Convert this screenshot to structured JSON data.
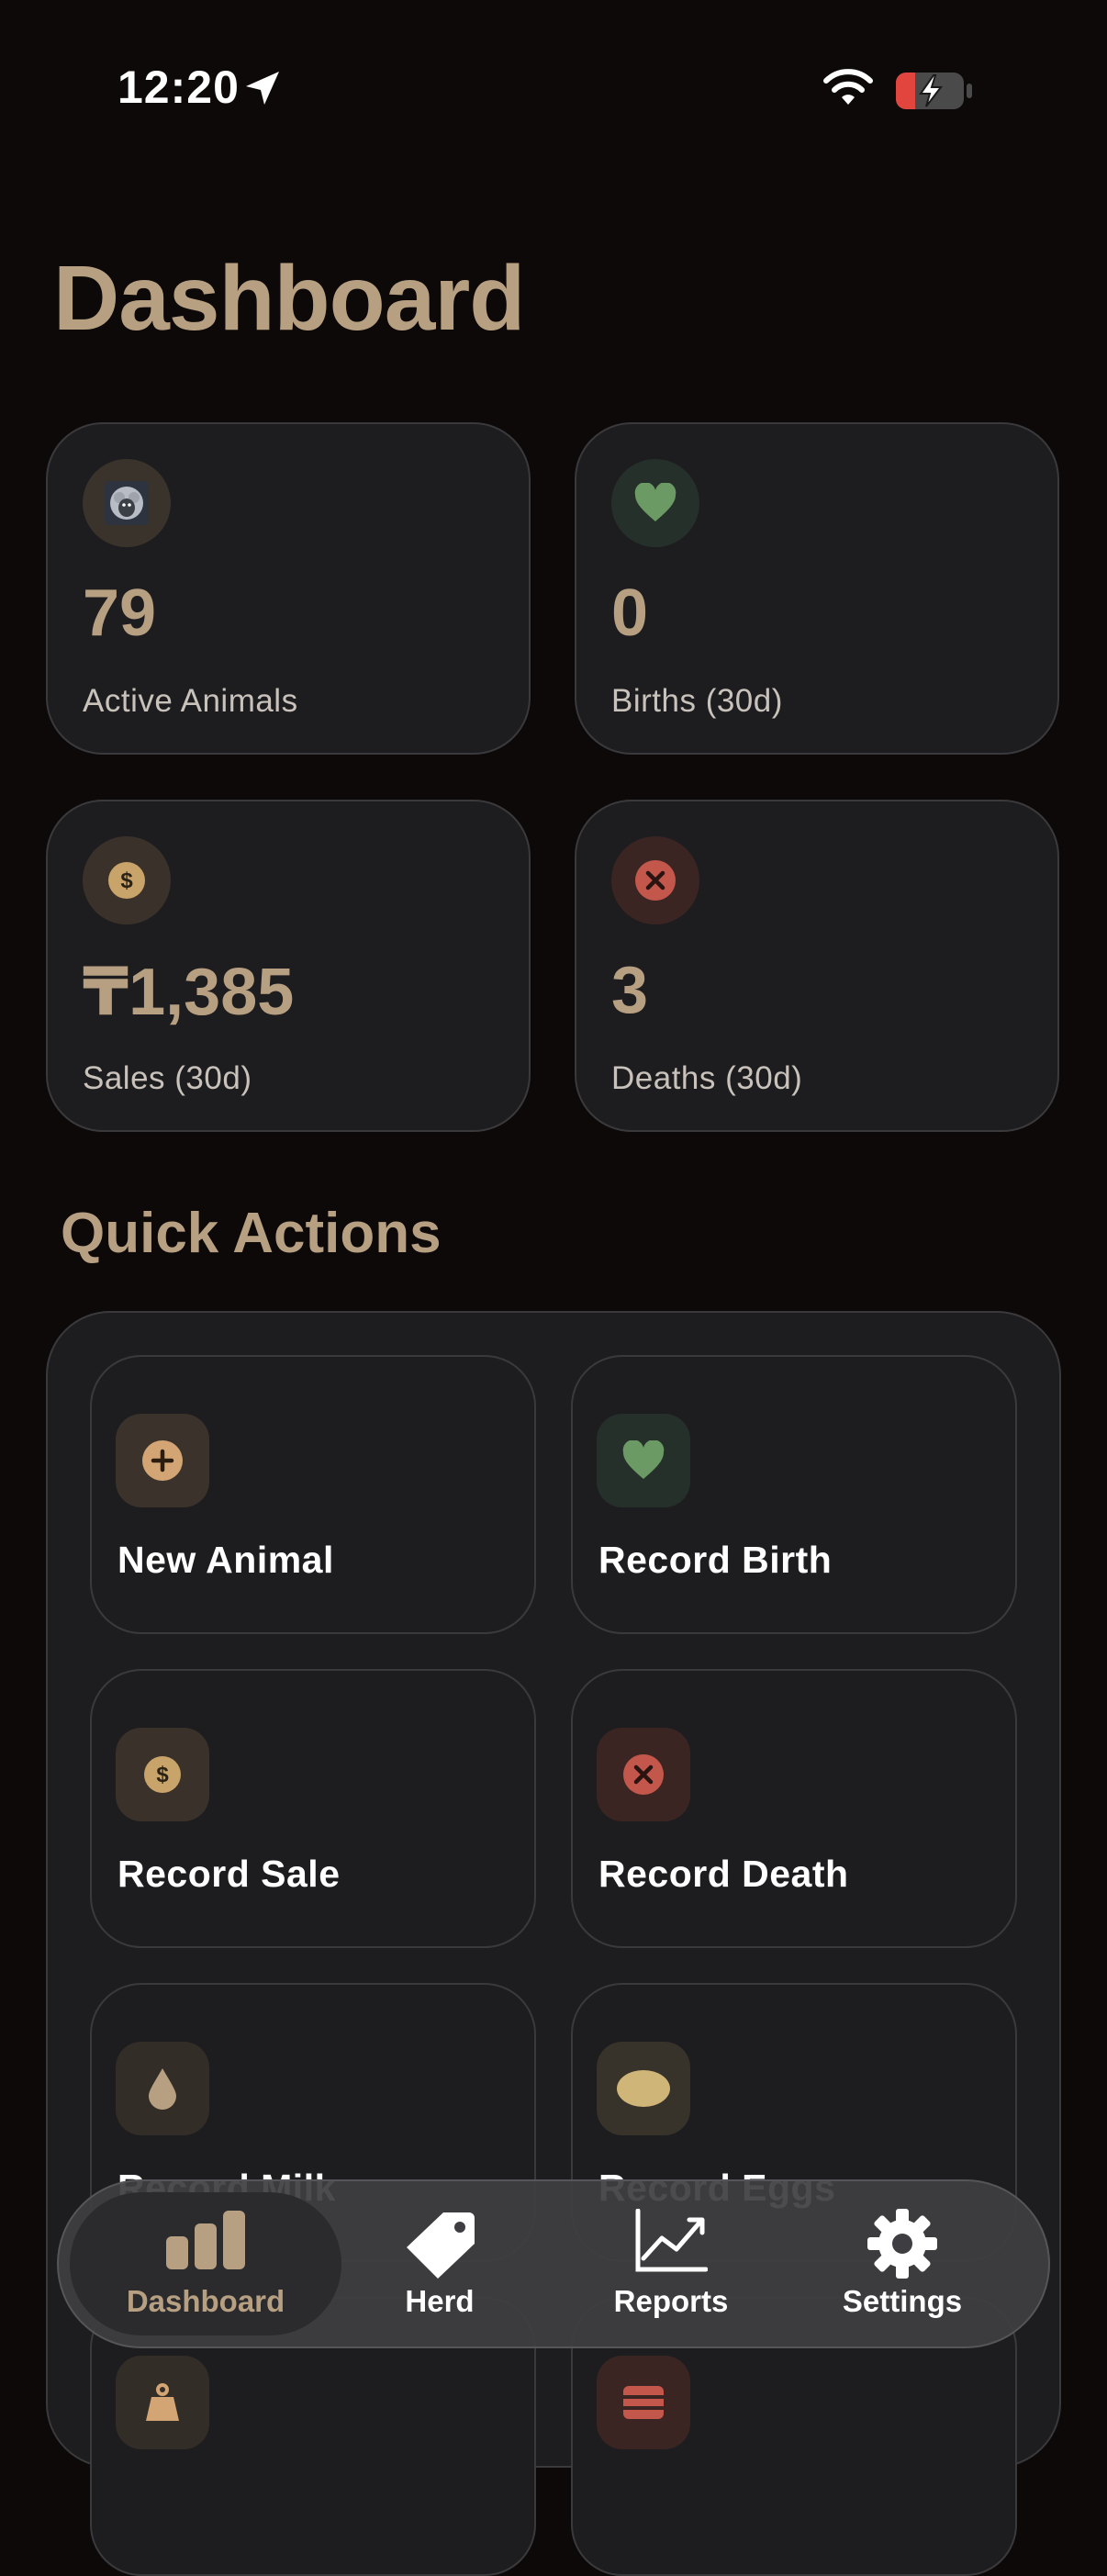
{
  "status_bar": {
    "time": "12:20"
  },
  "page": {
    "title": "Dashboard"
  },
  "stats": [
    {
      "value": "79",
      "label": "Active Animals",
      "icon": "sheep-icon"
    },
    {
      "value": "0",
      "label": "Births (30d)",
      "icon": "heart-icon"
    },
    {
      "value": "₸1,385",
      "label": "Sales (30d)",
      "icon": "dollar-icon"
    },
    {
      "value": "3",
      "label": "Deaths (30d)",
      "icon": "x-circle-icon"
    }
  ],
  "quick_actions": {
    "title": "Quick Actions",
    "items": [
      {
        "label": "New Animal",
        "icon": "plus-circle-icon"
      },
      {
        "label": "Record Birth",
        "icon": "heart-icon"
      },
      {
        "label": "Record Sale",
        "icon": "dollar-icon"
      },
      {
        "label": "Record Death",
        "icon": "x-circle-icon"
      },
      {
        "label": "Record Milk",
        "icon": "drop-icon"
      },
      {
        "label": "Record Eggs",
        "icon": "egg-icon"
      }
    ]
  },
  "tab_bar": {
    "tabs": [
      {
        "label": "Dashboard",
        "icon": "bar-chart-icon",
        "active": true
      },
      {
        "label": "Herd",
        "icon": "tag-icon",
        "active": false
      },
      {
        "label": "Reports",
        "icon": "line-chart-icon",
        "active": false
      },
      {
        "label": "Settings",
        "icon": "gear-icon",
        "active": false
      }
    ]
  },
  "colors": {
    "accent": "#b79f82",
    "green": "#6c9a64",
    "gold": "#c8a46a",
    "red": "#c4574b",
    "background": "#0c0908",
    "card": "#1d1d1f"
  }
}
